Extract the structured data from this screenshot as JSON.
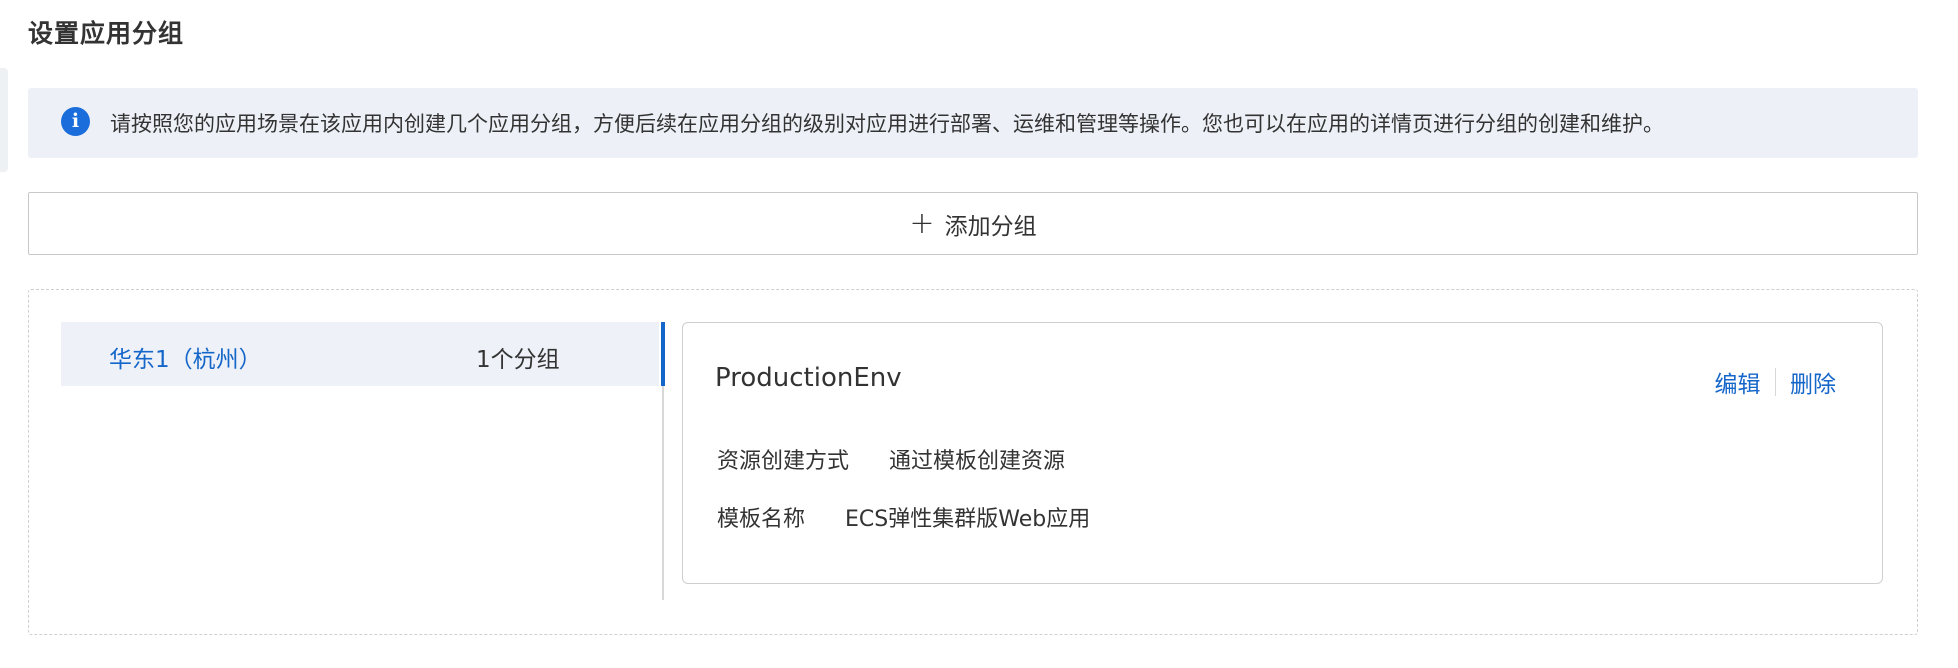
{
  "page": {
    "title": "设置应用分组"
  },
  "notice": {
    "icon": "info-icon",
    "icon_glyph": "i",
    "text": "请按照您的应用场景在该应用内创建几个应用分组，方便后续在应用分组的级别对应用进行部署、运维和管理等操作。您也可以在应用的详情页进行分组的创建和维护。"
  },
  "add_group": {
    "icon": "plus-icon",
    "icon_glyph": "+",
    "label": "添加分组"
  },
  "regions": [
    {
      "name": "华东1（杭州）",
      "count": "1个分组",
      "selected": true
    }
  ],
  "group_card": {
    "name": "ProductionEnv",
    "actions": {
      "edit": "编辑",
      "delete": "删除"
    },
    "fields": [
      {
        "label": "资源创建方式",
        "value": "通过模板创建资源"
      },
      {
        "label": "模板名称",
        "value": "ECS弹性集群版Web应用"
      }
    ]
  },
  "colors": {
    "accent": "#1566c9",
    "notice_bg": "#edf1f7",
    "selected_bg": "#eef2f8",
    "info_icon": "#1b6ddb"
  }
}
